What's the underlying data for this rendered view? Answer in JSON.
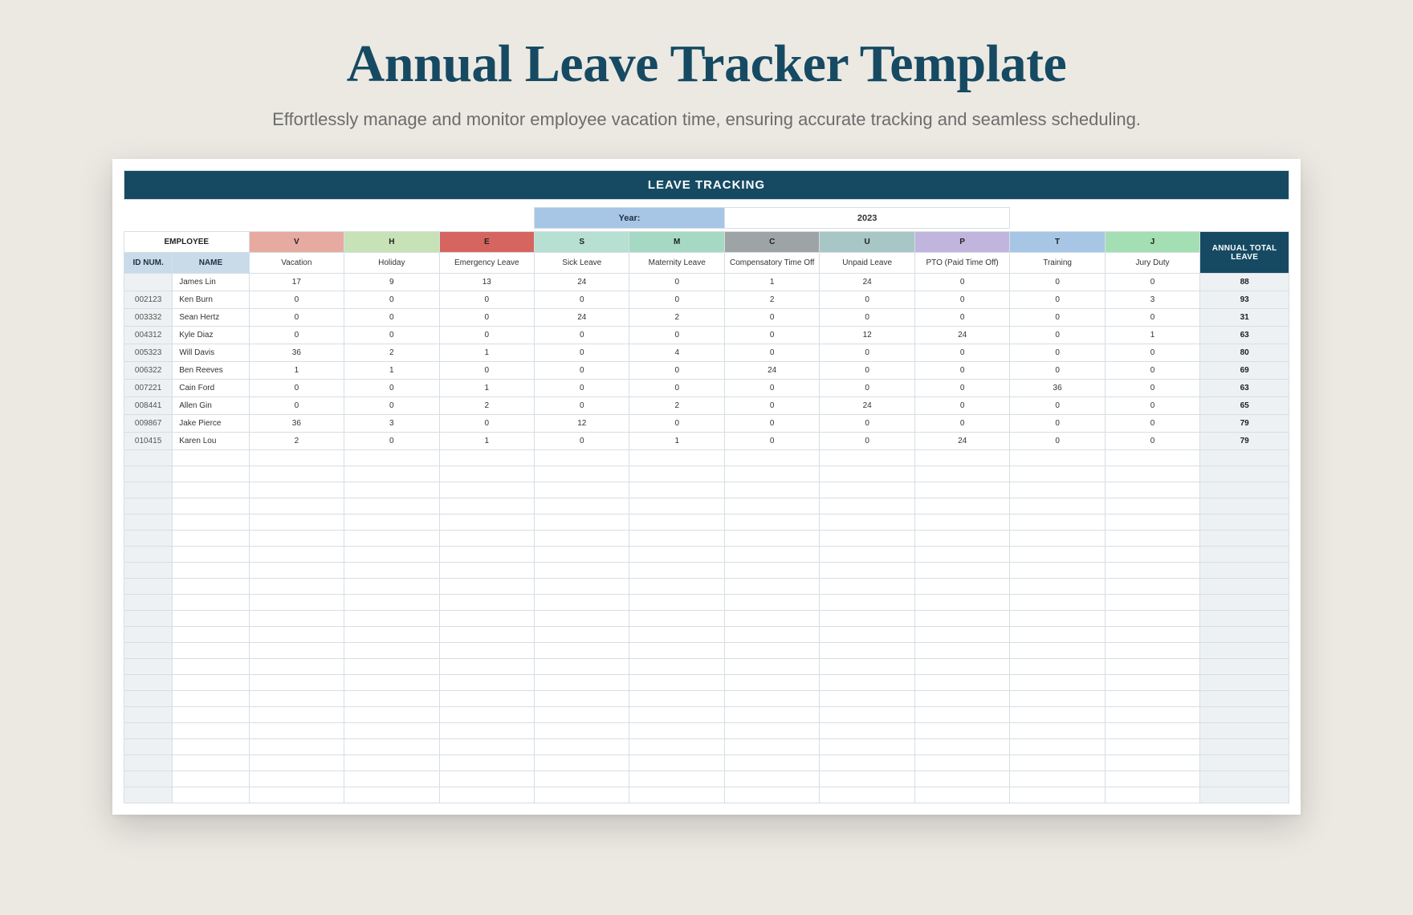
{
  "header": {
    "title": "Annual Leave Tracker Template",
    "subtitle": "Effortlessly manage and monitor employee vacation time, ensuring accurate tracking and seamless scheduling."
  },
  "sheet": {
    "banner": "LEAVE TRACKING",
    "year_label": "Year:",
    "year_value": "2023",
    "employee_header": "EMPLOYEE",
    "sub_headers": {
      "id": "ID NUM.",
      "name": "NAME"
    },
    "total_header": "ANNUAL TOTAL LEAVE",
    "leave_types": [
      {
        "code": "V",
        "label": "Vacation",
        "color": "#e6aaa1"
      },
      {
        "code": "H",
        "label": "Holiday",
        "color": "#c7e2b6"
      },
      {
        "code": "E",
        "label": "Emergency Leave",
        "color": "#d6655f"
      },
      {
        "code": "S",
        "label": "Sick Leave",
        "color": "#b7dfd2"
      },
      {
        "code": "M",
        "label": "Maternity Leave",
        "color": "#a6d9c4"
      },
      {
        "code": "C",
        "label": "Compensatory Time Off",
        "color": "#9ea3a6"
      },
      {
        "code": "U",
        "label": "Unpaid Leave",
        "color": "#a7c6c5"
      },
      {
        "code": "P",
        "label": "PTO (Paid Time Off)",
        "color": "#c1b5de"
      },
      {
        "code": "T",
        "label": "Training",
        "color": "#a7c6e6"
      },
      {
        "code": "J",
        "label": "Jury Duty",
        "color": "#a3dfb3"
      }
    ],
    "rows": [
      {
        "id": "",
        "name": "James Lin",
        "values": [
          17,
          9,
          13,
          24,
          0,
          1,
          24,
          0,
          0,
          0
        ],
        "total": 88
      },
      {
        "id": "002123",
        "name": "Ken Burn",
        "values": [
          0,
          0,
          0,
          0,
          0,
          2,
          0,
          0,
          0,
          3
        ],
        "total": 93
      },
      {
        "id": "003332",
        "name": "Sean Hertz",
        "values": [
          0,
          0,
          0,
          24,
          2,
          0,
          0,
          0,
          0,
          0
        ],
        "total": 31
      },
      {
        "id": "004312",
        "name": "Kyle Diaz",
        "values": [
          0,
          0,
          0,
          0,
          0,
          0,
          12,
          24,
          0,
          1
        ],
        "total": 63
      },
      {
        "id": "005323",
        "name": "Will Davis",
        "values": [
          36,
          2,
          1,
          0,
          4,
          0,
          0,
          0,
          0,
          0
        ],
        "total": 80
      },
      {
        "id": "006322",
        "name": "Ben Reeves",
        "values": [
          1,
          1,
          0,
          0,
          0,
          24,
          0,
          0,
          0,
          0
        ],
        "total": 69
      },
      {
        "id": "007221",
        "name": "Cain Ford",
        "values": [
          0,
          0,
          1,
          0,
          0,
          0,
          0,
          0,
          36,
          0
        ],
        "total": 63
      },
      {
        "id": "008441",
        "name": "Allen Gin",
        "values": [
          0,
          0,
          2,
          0,
          2,
          0,
          24,
          0,
          0,
          0
        ],
        "total": 65
      },
      {
        "id": "009867",
        "name": "Jake Pierce",
        "values": [
          36,
          3,
          0,
          12,
          0,
          0,
          0,
          0,
          0,
          0
        ],
        "total": 79
      },
      {
        "id": "010415",
        "name": "Karen Lou",
        "values": [
          2,
          0,
          1,
          0,
          1,
          0,
          0,
          24,
          0,
          0
        ],
        "total": 79
      }
    ],
    "empty_rows": 22
  },
  "chart_data": {
    "type": "table",
    "title": "LEAVE TRACKING",
    "year": 2023,
    "columns": [
      "ID NUM.",
      "NAME",
      "Vacation",
      "Holiday",
      "Emergency Leave",
      "Sick Leave",
      "Maternity Leave",
      "Compensatory Time Off",
      "Unpaid Leave",
      "PTO (Paid Time Off)",
      "Training",
      "Jury Duty",
      "ANNUAL TOTAL LEAVE"
    ],
    "rows": [
      [
        "",
        "James Lin",
        17,
        9,
        13,
        24,
        0,
        1,
        24,
        0,
        0,
        0,
        88
      ],
      [
        "002123",
        "Ken Burn",
        0,
        0,
        0,
        0,
        0,
        2,
        0,
        0,
        0,
        3,
        93
      ],
      [
        "003332",
        "Sean Hertz",
        0,
        0,
        0,
        24,
        2,
        0,
        0,
        0,
        0,
        0,
        31
      ],
      [
        "004312",
        "Kyle Diaz",
        0,
        0,
        0,
        0,
        0,
        0,
        12,
        24,
        0,
        1,
        63
      ],
      [
        "005323",
        "Will Davis",
        36,
        2,
        1,
        0,
        4,
        0,
        0,
        0,
        0,
        0,
        80
      ],
      [
        "006322",
        "Ben Reeves",
        1,
        1,
        0,
        0,
        0,
        24,
        0,
        0,
        0,
        0,
        69
      ],
      [
        "007221",
        "Cain Ford",
        0,
        0,
        1,
        0,
        0,
        0,
        0,
        0,
        36,
        0,
        63
      ],
      [
        "008441",
        "Allen Gin",
        0,
        0,
        2,
        0,
        2,
        0,
        24,
        0,
        0,
        0,
        65
      ],
      [
        "009867",
        "Jake Pierce",
        36,
        3,
        0,
        12,
        0,
        0,
        0,
        0,
        0,
        0,
        79
      ],
      [
        "010415",
        "Karen Lou",
        2,
        0,
        1,
        0,
        1,
        0,
        0,
        24,
        0,
        0,
        79
      ]
    ]
  }
}
